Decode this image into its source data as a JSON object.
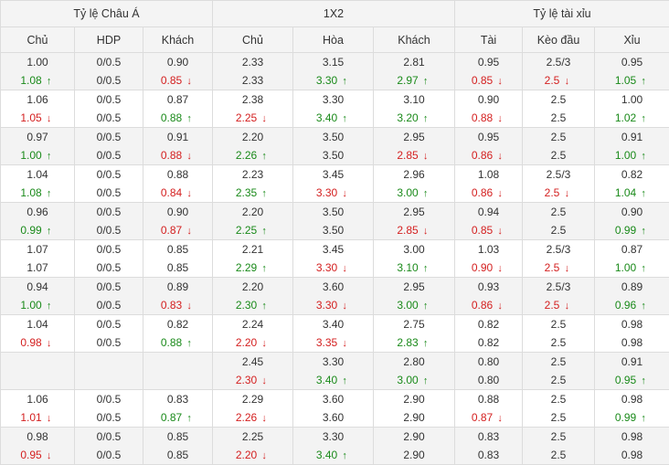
{
  "headers": {
    "groups": [
      "Tỷ lệ Châu Á",
      "1X2",
      "Tỷ lệ tài xỉu"
    ],
    "columns": [
      "Chủ",
      "HDP",
      "Khách",
      "Chủ",
      "Hòa",
      "Khách",
      "Tài",
      "Kèo đầu",
      "Xỉu"
    ]
  },
  "colors": {
    "up": "#1a8a1a",
    "down": "#d42020"
  },
  "rows": [
    [
      [
        "1.00",
        "1.08",
        "up"
      ],
      [
        "0/0.5",
        "0/0.5",
        ""
      ],
      [
        "0.90",
        "0.85",
        "down"
      ],
      [
        "2.33",
        "2.33",
        ""
      ],
      [
        "3.15",
        "3.30",
        "up"
      ],
      [
        "2.81",
        "2.97",
        "up"
      ],
      [
        "0.95",
        "0.85",
        "down"
      ],
      [
        "2.5/3",
        "2.5",
        "down"
      ],
      [
        "0.95",
        "1.05",
        "up"
      ]
    ],
    [
      [
        "1.06",
        "1.05",
        "down"
      ],
      [
        "0/0.5",
        "0/0.5",
        ""
      ],
      [
        "0.87",
        "0.88",
        "up"
      ],
      [
        "2.38",
        "2.25",
        "down"
      ],
      [
        "3.30",
        "3.40",
        "up"
      ],
      [
        "3.10",
        "3.20",
        "up"
      ],
      [
        "0.90",
        "0.88",
        "down"
      ],
      [
        "2.5",
        "2.5",
        ""
      ],
      [
        "1.00",
        "1.02",
        "up"
      ]
    ],
    [
      [
        "0.97",
        "1.00",
        "up"
      ],
      [
        "0/0.5",
        "0/0.5",
        ""
      ],
      [
        "0.91",
        "0.88",
        "down"
      ],
      [
        "2.20",
        "2.26",
        "up"
      ],
      [
        "3.50",
        "3.50",
        ""
      ],
      [
        "2.95",
        "2.85",
        "down"
      ],
      [
        "0.95",
        "0.86",
        "down"
      ],
      [
        "2.5",
        "2.5",
        ""
      ],
      [
        "0.91",
        "1.00",
        "up"
      ]
    ],
    [
      [
        "1.04",
        "1.08",
        "up"
      ],
      [
        "0/0.5",
        "0/0.5",
        ""
      ],
      [
        "0.88",
        "0.84",
        "down"
      ],
      [
        "2.23",
        "2.35",
        "up"
      ],
      [
        "3.45",
        "3.30",
        "down"
      ],
      [
        "2.96",
        "3.00",
        "up"
      ],
      [
        "1.08",
        "0.86",
        "down"
      ],
      [
        "2.5/3",
        "2.5",
        "down"
      ],
      [
        "0.82",
        "1.04",
        "up"
      ]
    ],
    [
      [
        "0.96",
        "0.99",
        "up"
      ],
      [
        "0/0.5",
        "0/0.5",
        ""
      ],
      [
        "0.90",
        "0.87",
        "down"
      ],
      [
        "2.20",
        "2.25",
        "up"
      ],
      [
        "3.50",
        "3.50",
        ""
      ],
      [
        "2.95",
        "2.85",
        "down"
      ],
      [
        "0.94",
        "0.85",
        "down"
      ],
      [
        "2.5",
        "2.5",
        ""
      ],
      [
        "0.90",
        "0.99",
        "up"
      ]
    ],
    [
      [
        "1.07",
        "1.07",
        ""
      ],
      [
        "0/0.5",
        "0/0.5",
        ""
      ],
      [
        "0.85",
        "0.85",
        ""
      ],
      [
        "2.21",
        "2.29",
        "up"
      ],
      [
        "3.45",
        "3.30",
        "down"
      ],
      [
        "3.00",
        "3.10",
        "up"
      ],
      [
        "1.03",
        "0.90",
        "down"
      ],
      [
        "2.5/3",
        "2.5",
        "down"
      ],
      [
        "0.87",
        "1.00",
        "up"
      ]
    ],
    [
      [
        "0.94",
        "1.00",
        "up"
      ],
      [
        "0/0.5",
        "0/0.5",
        ""
      ],
      [
        "0.89",
        "0.83",
        "down"
      ],
      [
        "2.20",
        "2.30",
        "up"
      ],
      [
        "3.60",
        "3.30",
        "down"
      ],
      [
        "2.95",
        "3.00",
        "up"
      ],
      [
        "0.93",
        "0.86",
        "down"
      ],
      [
        "2.5/3",
        "2.5",
        "down"
      ],
      [
        "0.89",
        "0.96",
        "up"
      ]
    ],
    [
      [
        "1.04",
        "0.98",
        "down"
      ],
      [
        "0/0.5",
        "0/0.5",
        ""
      ],
      [
        "0.82",
        "0.88",
        "up"
      ],
      [
        "2.24",
        "2.20",
        "down"
      ],
      [
        "3.40",
        "3.35",
        "down"
      ],
      [
        "2.75",
        "2.83",
        "up"
      ],
      [
        "0.82",
        "0.82",
        ""
      ],
      [
        "2.5",
        "2.5",
        ""
      ],
      [
        "0.98",
        "0.98",
        ""
      ]
    ],
    [
      [
        "",
        "",
        ""
      ],
      [
        "",
        "",
        ""
      ],
      [
        "",
        "",
        ""
      ],
      [
        "2.45",
        "2.30",
        "down"
      ],
      [
        "3.30",
        "3.40",
        "up"
      ],
      [
        "2.80",
        "3.00",
        "up"
      ],
      [
        "0.80",
        "0.80",
        ""
      ],
      [
        "2.5",
        "2.5",
        ""
      ],
      [
        "0.91",
        "0.95",
        "up"
      ]
    ],
    [
      [
        "1.06",
        "1.01",
        "down"
      ],
      [
        "0/0.5",
        "0/0.5",
        ""
      ],
      [
        "0.83",
        "0.87",
        "up"
      ],
      [
        "2.29",
        "2.26",
        "down"
      ],
      [
        "3.60",
        "3.60",
        ""
      ],
      [
        "2.90",
        "2.90",
        ""
      ],
      [
        "0.88",
        "0.87",
        "down"
      ],
      [
        "2.5",
        "2.5",
        ""
      ],
      [
        "0.98",
        "0.99",
        "up"
      ]
    ],
    [
      [
        "0.98",
        "0.95",
        "down"
      ],
      [
        "0/0.5",
        "0/0.5",
        ""
      ],
      [
        "0.85",
        "0.85",
        ""
      ],
      [
        "2.25",
        "2.20",
        "down"
      ],
      [
        "3.30",
        "3.40",
        "up"
      ],
      [
        "2.90",
        "2.90",
        ""
      ],
      [
        "0.83",
        "0.83",
        ""
      ],
      [
        "2.5",
        "2.5",
        ""
      ],
      [
        "0.98",
        "0.98",
        ""
      ]
    ]
  ]
}
